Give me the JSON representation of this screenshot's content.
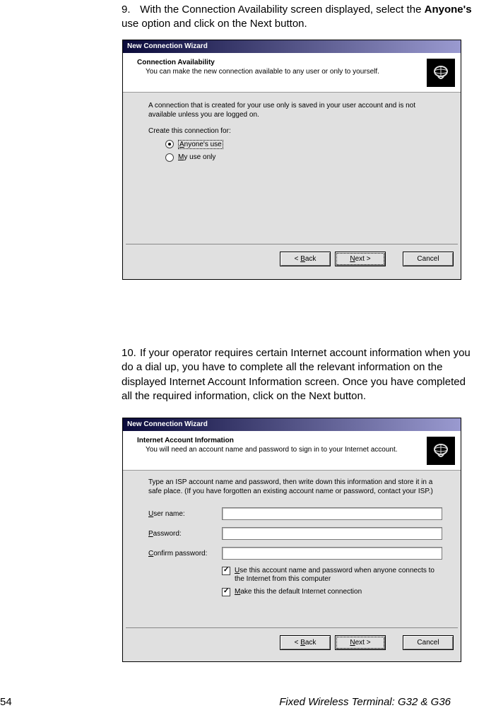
{
  "step9": {
    "number": "9.",
    "text_pre": "With the Connection Availability screen displayed, select the ",
    "bold": "Anyone's",
    "text_post": " use option and click on the Next button."
  },
  "step10": {
    "number": "10.",
    "text": "If your operator requires certain Internet account information when you do a dial up, you have to complete all the relevant information on the displayed Internet Account Information screen.  Once you have completed all the required information, click on the Next button."
  },
  "wizard1": {
    "title": "New Connection Wizard",
    "header_title": "Connection Availability",
    "header_sub": "You can make the new connection available to any user or only to yourself.",
    "body_p1": "A connection that is created for your use only is saved in your user account and is not available unless you are logged on.",
    "body_p2": "Create this connection for:",
    "radio1_key": "A",
    "radio1_rest": "nyone's use",
    "radio2_key": "M",
    "radio2_rest": "y use only"
  },
  "wizard2": {
    "title": "New Connection Wizard",
    "header_title": "Internet Account Information",
    "header_sub": "You will need an account name and password to sign in to your Internet account.",
    "body_p1": "Type an ISP account name and password, then write down this information and store it in a safe place. (If you have forgotten an existing account name or password, contact your ISP.)",
    "label_user_key": "U",
    "label_user_rest": "ser name:",
    "label_pass_key": "P",
    "label_pass_rest": "assword:",
    "label_conf_key": "C",
    "label_conf_rest": "onfirm password:",
    "check1_key": "U",
    "check1_rest": "se this account name and password when anyone connects to the Internet from this computer",
    "check2_key": "M",
    "check2_rest": "ake this the default Internet connection"
  },
  "buttons": {
    "back_key": "B",
    "back_pre": "< ",
    "back_rest": "ack",
    "next_key": "N",
    "next_rest": "ext >",
    "cancel": "Cancel"
  },
  "footer": {
    "page": "54",
    "title": "Fixed Wireless Terminal: G32 & G36"
  }
}
